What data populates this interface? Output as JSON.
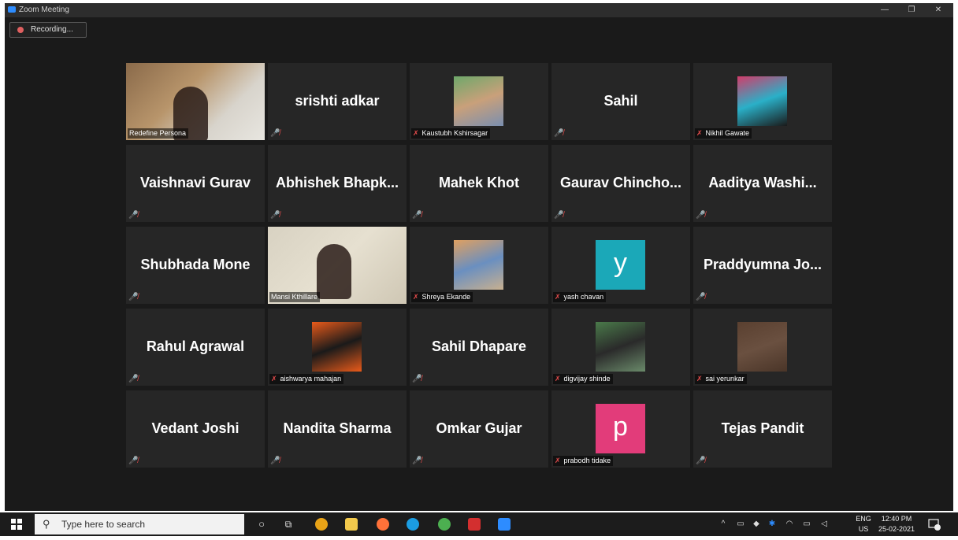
{
  "window": {
    "title": "Zoom Meeting",
    "minimize": "—",
    "restore": "❐",
    "close": "✕"
  },
  "recording": {
    "label": "Recording..."
  },
  "participants": [
    {
      "name": "Redefine Persona",
      "type": "video",
      "muted": false
    },
    {
      "name": "srishti adkar",
      "type": "name",
      "muted": true
    },
    {
      "name": "Kaustubh Kshirsagar",
      "type": "photo",
      "muted": true
    },
    {
      "name": "Sahil",
      "type": "name",
      "muted": true
    },
    {
      "name": "Nikhil Gawate",
      "type": "photo",
      "muted": true
    },
    {
      "name": "Vaishnavi Gurav",
      "type": "name",
      "muted": true
    },
    {
      "name": "Abhishek Bhapk...",
      "type": "name",
      "muted": true
    },
    {
      "name": "Mahek Khot",
      "type": "name",
      "muted": true
    },
    {
      "name": "Gaurav Chincho...",
      "type": "name",
      "muted": true
    },
    {
      "name": "Aaditya Washi...",
      "type": "name",
      "muted": true
    },
    {
      "name": "Shubhada Mone",
      "type": "name",
      "muted": true
    },
    {
      "name": "Mansi Kthillare",
      "type": "video",
      "muted": false,
      "active": true
    },
    {
      "name": "Shreya Ekande",
      "type": "photo",
      "muted": true
    },
    {
      "name": "yash chavan",
      "type": "letter",
      "letter": "y",
      "color": "#1ba8b8",
      "muted": true
    },
    {
      "name": "Praddyumna Jo...",
      "type": "name",
      "muted": true
    },
    {
      "name": "Rahul Agrawal",
      "type": "name",
      "muted": true
    },
    {
      "name": "aishwarya mahajan",
      "type": "photo",
      "muted": true
    },
    {
      "name": "Sahil Dhapare",
      "type": "name",
      "muted": true
    },
    {
      "name": "digvijay shinde",
      "type": "photo",
      "muted": true
    },
    {
      "name": "sai yerunkar",
      "type": "photo",
      "muted": true
    },
    {
      "name": "Vedant Joshi",
      "type": "name",
      "muted": true
    },
    {
      "name": "Nandita Sharma",
      "type": "name",
      "muted": true
    },
    {
      "name": "Omkar Gujar",
      "type": "name",
      "muted": true
    },
    {
      "name": "prabodh tidake",
      "type": "letter",
      "letter": "p",
      "color": "#e23c7a",
      "muted": true
    },
    {
      "name": "Tejas Pandit",
      "type": "name",
      "muted": true
    }
  ],
  "taskbar": {
    "search_placeholder": "Type here to search",
    "lang_top": "ENG",
    "lang_bottom": "US",
    "time": "12:40 PM",
    "date": "25-02-2021",
    "notification_count": "1"
  }
}
